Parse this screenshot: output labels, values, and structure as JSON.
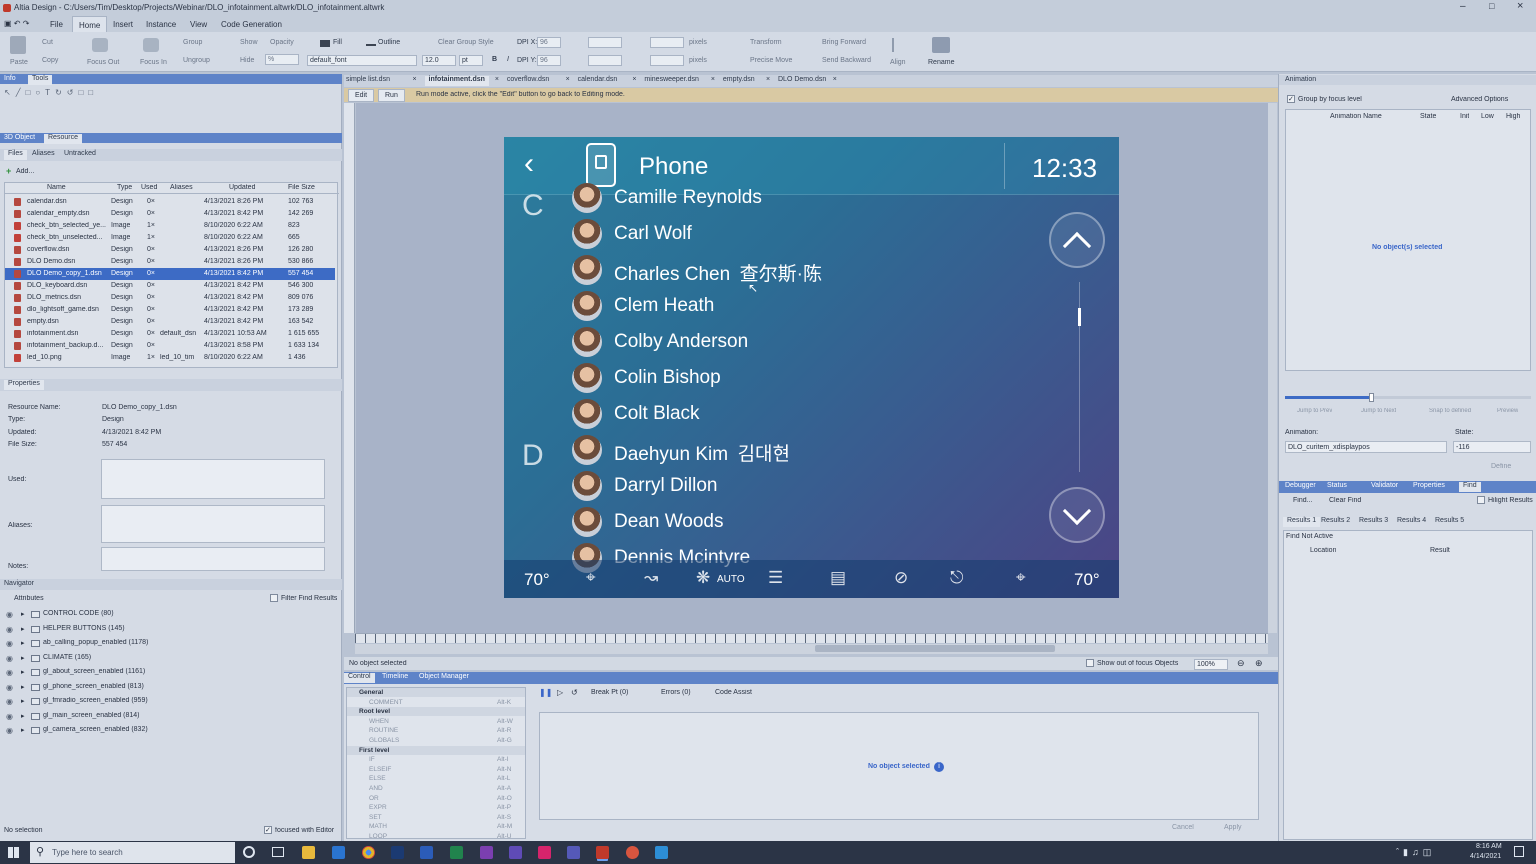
{
  "window": {
    "title": "Altia Design - C:/Users/Tim/Desktop/Projects/Webinar/DLO_infotainment.altwrk/DLO_infotainment.altwrk"
  },
  "menu": [
    "File",
    "Home",
    "Insert",
    "Instance",
    "View",
    "Code Generation"
  ],
  "ribbon": {
    "clipboard": [
      "Paste",
      "Cut",
      "Copy"
    ],
    "focus": [
      "Focus Out",
      "Focus In"
    ],
    "group": [
      "Group",
      "Ungroup"
    ],
    "visibility": [
      "Show",
      "Hide",
      "Opacity",
      "%"
    ],
    "fill": "Fill",
    "outline": "Outline",
    "clear_group_style": "Clear Group Style",
    "font": "default_font",
    "font_size": "12.0",
    "font_unit": "pt",
    "bold": "B",
    "italic": "I",
    "dpi_x_label": "DPI X:",
    "dpi_x": "96",
    "dpi_y_label": "DPI Y:",
    "dpi_y": "96",
    "units": [
      "pixels",
      "pixels"
    ],
    "transform": "Transform",
    "precise_move": "Precise Move",
    "bring_forward": "Bring Forward",
    "send_backward": "Send Backward",
    "align": "Align",
    "rename": "Rename"
  },
  "left": {
    "top_tabs": [
      "Info",
      "Tools"
    ],
    "resource_tabs": [
      "3D Object",
      "Resource"
    ],
    "file_tabs": [
      "Files",
      "Aliases",
      "Untracked"
    ],
    "add_label": "Add...",
    "columns": [
      "Name",
      "Type",
      "Used",
      "Aliases",
      "Updated",
      "File Size"
    ],
    "rows": [
      [
        "calendar.dsn",
        "Design",
        "0×",
        "",
        "4/13/2021 8:26 PM",
        "102 763"
      ],
      [
        "calendar_empty.dsn",
        "Design",
        "0×",
        "",
        "4/13/2021 8:42 PM",
        "142 269"
      ],
      [
        "check_btn_selected_ye...",
        "Image",
        "1×",
        "",
        "8/10/2020 6:22 AM",
        "823"
      ],
      [
        "check_btn_unselected...",
        "Image",
        "1×",
        "",
        "8/10/2020 6:22 AM",
        "665"
      ],
      [
        "coverflow.dsn",
        "Design",
        "0×",
        "",
        "4/13/2021 8:26 PM",
        "126 280"
      ],
      [
        "DLO Demo.dsn",
        "Design",
        "0×",
        "",
        "4/13/2021 8:26 PM",
        "530 866"
      ],
      [
        "DLO Demo_copy_1.dsn",
        "Design",
        "0×",
        "",
        "4/13/2021 8:42 PM",
        "557 454"
      ],
      [
        "DLO_keyboard.dsn",
        "Design",
        "0×",
        "",
        "4/13/2021 8:42 PM",
        "546 300"
      ],
      [
        "DLO_metrics.dsn",
        "Design",
        "0×",
        "",
        "4/13/2021 8:42 PM",
        "809 076"
      ],
      [
        "dlo_lightsoff_game.dsn",
        "Design",
        "0×",
        "",
        "4/13/2021 8:42 PM",
        "173 289"
      ],
      [
        "empty.dsn",
        "Design",
        "0×",
        "",
        "4/13/2021 8:42 PM",
        "163 542"
      ],
      [
        "infotainment.dsn",
        "Design",
        "0×",
        "default_dsn",
        "4/13/2021 10:53 AM",
        "1 615 655"
      ],
      [
        "infotainment_backup.d...",
        "Design",
        "0×",
        "",
        "4/13/2021 8:58 PM",
        "1 633 134"
      ],
      [
        "led_10.png",
        "Image",
        "1×",
        "led_10_tim",
        "8/10/2020 6:22 AM",
        "1 436"
      ]
    ],
    "properties": {
      "header": "Properties",
      "labels": [
        "Resource Name:",
        "Type:",
        "Updated:",
        "File Size:",
        "Used:",
        "Aliases:",
        "Notes:"
      ],
      "values": [
        "DLO Demo_copy_1.dsn",
        "Design",
        "4/13/2021 8:42 PM",
        "557 454"
      ]
    },
    "navigator": {
      "header": "Navigator",
      "attributes": "Attributes",
      "filter": "Filter Find Results",
      "items": [
        "CONTROL CODE (80)",
        "HELPER BUTTONS (145)",
        "ab_calling_popup_enabled (1178)",
        "CLIMATE (165)",
        "gl_about_screen_enabled (1161)",
        "gl_phone_screen_enabled (813)",
        "gl_fmradio_screen_enabled (959)",
        "gl_main_screen_enabled (814)",
        "gl_camera_screen_enabled (832)"
      ]
    },
    "status": "No selection",
    "focused_with_editor": "focused with Editor"
  },
  "doc_tabs": [
    "simple list.dsn",
    "infotainment.dsn",
    "coverflow.dsn",
    "calendar.dsn",
    "minesweeper.dsn",
    "empty.dsn",
    "DLO Demo.dsn"
  ],
  "mode_bar": {
    "edit": "Edit",
    "run": "Run",
    "message": "Run mode active, click the \"Edit\" button to go back to Editing mode."
  },
  "ivi": {
    "title": "Phone",
    "clock": "12:33",
    "letters": [
      "C",
      "D"
    ],
    "contacts": [
      {
        "name": "Camille Reynolds",
        "native": ""
      },
      {
        "name": "Carl Wolf",
        "native": ""
      },
      {
        "name": "Charles Chen",
        "native": "查尔斯·陈"
      },
      {
        "name": "Clem Heath",
        "native": ""
      },
      {
        "name": "Colby Anderson",
        "native": ""
      },
      {
        "name": "Colin Bishop",
        "native": ""
      },
      {
        "name": "Colt Black",
        "native": ""
      },
      {
        "name": "Daehyun Kim",
        "native": "김대현"
      },
      {
        "name": "Darryl Dillon",
        "native": ""
      },
      {
        "name": "Dean Woods",
        "native": ""
      },
      {
        "name": "Dennis Mcintyre",
        "native": ""
      }
    ],
    "temp_left": "70°",
    "temp_right": "70°",
    "auto": "AUTO"
  },
  "canvas_status": {
    "selected": "No object selected",
    "show_out": "Show out of focus Objects",
    "zoom": "100%"
  },
  "bottom": {
    "tabs": [
      "Control",
      "Timeline",
      "Object Manager"
    ],
    "toolbar": [
      "Break Pt (0)",
      "Errors (0)",
      "Code Assist"
    ],
    "tree": [
      {
        "label": "General",
        "hdr": true,
        "key": ""
      },
      {
        "label": "COMMENT",
        "hdr": false,
        "key": "Alt-K"
      },
      {
        "label": "Root level",
        "hdr": true,
        "key": ""
      },
      {
        "label": "WHEN",
        "hdr": false,
        "key": "Alt-W"
      },
      {
        "label": "ROUTINE",
        "hdr": false,
        "key": "Alt-R"
      },
      {
        "label": "GLOBALS",
        "hdr": false,
        "key": "Alt-G"
      },
      {
        "label": "First level",
        "hdr": true,
        "key": ""
      },
      {
        "label": "IF",
        "hdr": false,
        "key": "Alt-I"
      },
      {
        "label": "ELSEIF",
        "hdr": false,
        "key": "Alt-N"
      },
      {
        "label": "ELSE",
        "hdr": false,
        "key": "Alt-L"
      },
      {
        "label": "AND",
        "hdr": false,
        "key": "Alt-A"
      },
      {
        "label": "OR",
        "hdr": false,
        "key": "Alt-O"
      },
      {
        "label": "EXPR",
        "hdr": false,
        "key": "Alt-P"
      },
      {
        "label": "SET",
        "hdr": false,
        "key": "Alt-S"
      },
      {
        "label": "MATH",
        "hdr": false,
        "key": "Alt-M"
      },
      {
        "label": "LOOP",
        "hdr": false,
        "key": "Alt-U"
      }
    ],
    "no_object": "No object selected",
    "cancel": "Cancel",
    "apply": "Apply"
  },
  "right": {
    "header": "Animation",
    "group_by": "Group by focus level",
    "advanced": "Advanced Options",
    "columns": [
      "Animation Name",
      "State",
      "Init",
      "Low",
      "High"
    ],
    "no_objects": "No object(s) selected",
    "jump_buttons": [
      "Jump to Prev",
      "Jump to Next",
      "Snap to defined",
      "Preview"
    ],
    "animation_label": "Animation:",
    "animation_value": "DLO_curitem_xdisplaypos",
    "state_label": "State:",
    "state_value": "-116",
    "define": "Define",
    "tabs": [
      "Debugger",
      "Status",
      "Validator",
      "Properties",
      "Find"
    ],
    "find": "Find...",
    "clear_find": "Clear Find",
    "highlight": "Hilight Results",
    "result_tabs": [
      "Results 1",
      "Results 2",
      "Results 3",
      "Results 4",
      "Results 5"
    ],
    "find_status": "Find Not Active",
    "result_columns": [
      "Location",
      "Result"
    ]
  },
  "taskbar": {
    "search": "Type here to search",
    "time": "8:16 AM",
    "date": "4/14/2021"
  }
}
